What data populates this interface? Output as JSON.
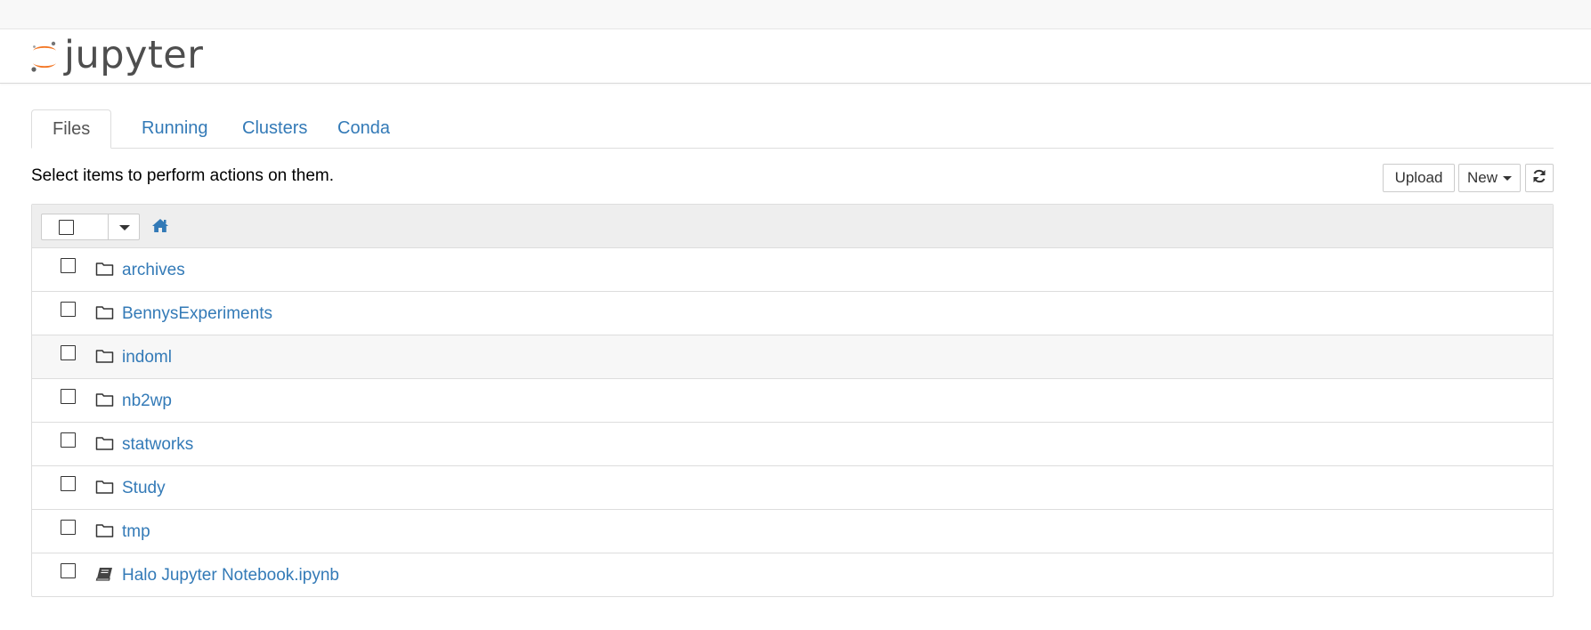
{
  "app": {
    "brand": "jupyter",
    "accent": "#f37726"
  },
  "tabs": [
    {
      "label": "Files",
      "active": true
    },
    {
      "label": "Running",
      "active": false
    },
    {
      "label": "Clusters",
      "active": false
    },
    {
      "label": "Conda",
      "active": false
    }
  ],
  "toolbar": {
    "instructions": "Select items to perform actions on them.",
    "upload_label": "Upload",
    "new_label": "New",
    "refresh_icon": "refresh-icon"
  },
  "list": {
    "home_icon": "home-icon",
    "items": [
      {
        "name": "archives",
        "type": "folder"
      },
      {
        "name": "BennysExperiments",
        "type": "folder"
      },
      {
        "name": "indoml",
        "type": "folder"
      },
      {
        "name": "nb2wp",
        "type": "folder"
      },
      {
        "name": "statworks",
        "type": "folder"
      },
      {
        "name": "Study",
        "type": "folder"
      },
      {
        "name": "tmp",
        "type": "folder"
      },
      {
        "name": "Halo Jupyter Notebook.ipynb",
        "type": "notebook"
      }
    ]
  },
  "colors": {
    "link": "#337ab7",
    "border": "#dddddd",
    "header_bg": "#eeeeee"
  }
}
